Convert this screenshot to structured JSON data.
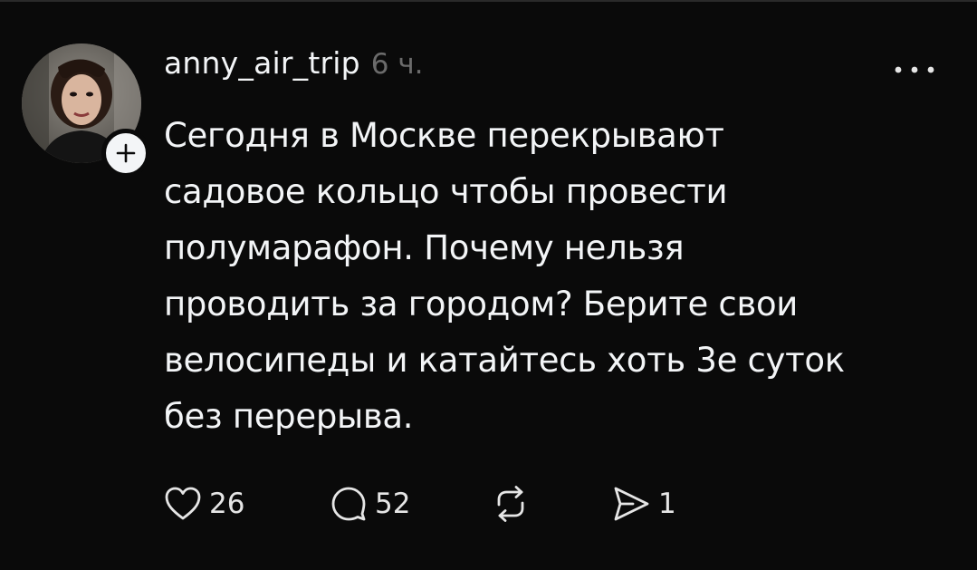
{
  "post": {
    "author": {
      "username": "anny_air_trip",
      "avatar_icon": "profile-photo",
      "follow_icon": "plus-icon"
    },
    "timestamp": "6 ч.",
    "more_icon": "more-horizontal-icon",
    "text": "Сегодня в Москве перекрывают\nсадовое кольцо чтобы провести\nполумарафон. Почему нельзя\nпроводить за городом? Берите свои\nвелосипеды и катайтесь хоть 3е суток\nбез перерыва.",
    "actions": {
      "likes": {
        "icon": "heart-icon",
        "count": "26"
      },
      "replies": {
        "icon": "comment-icon",
        "count": "52"
      },
      "reposts": {
        "icon": "repost-icon",
        "count": ""
      },
      "shares": {
        "icon": "send-icon",
        "count": "1"
      }
    }
  },
  "colors": {
    "background": "#0a0a0a",
    "text": "#f3f5f7",
    "muted": "#6b6b6b"
  }
}
